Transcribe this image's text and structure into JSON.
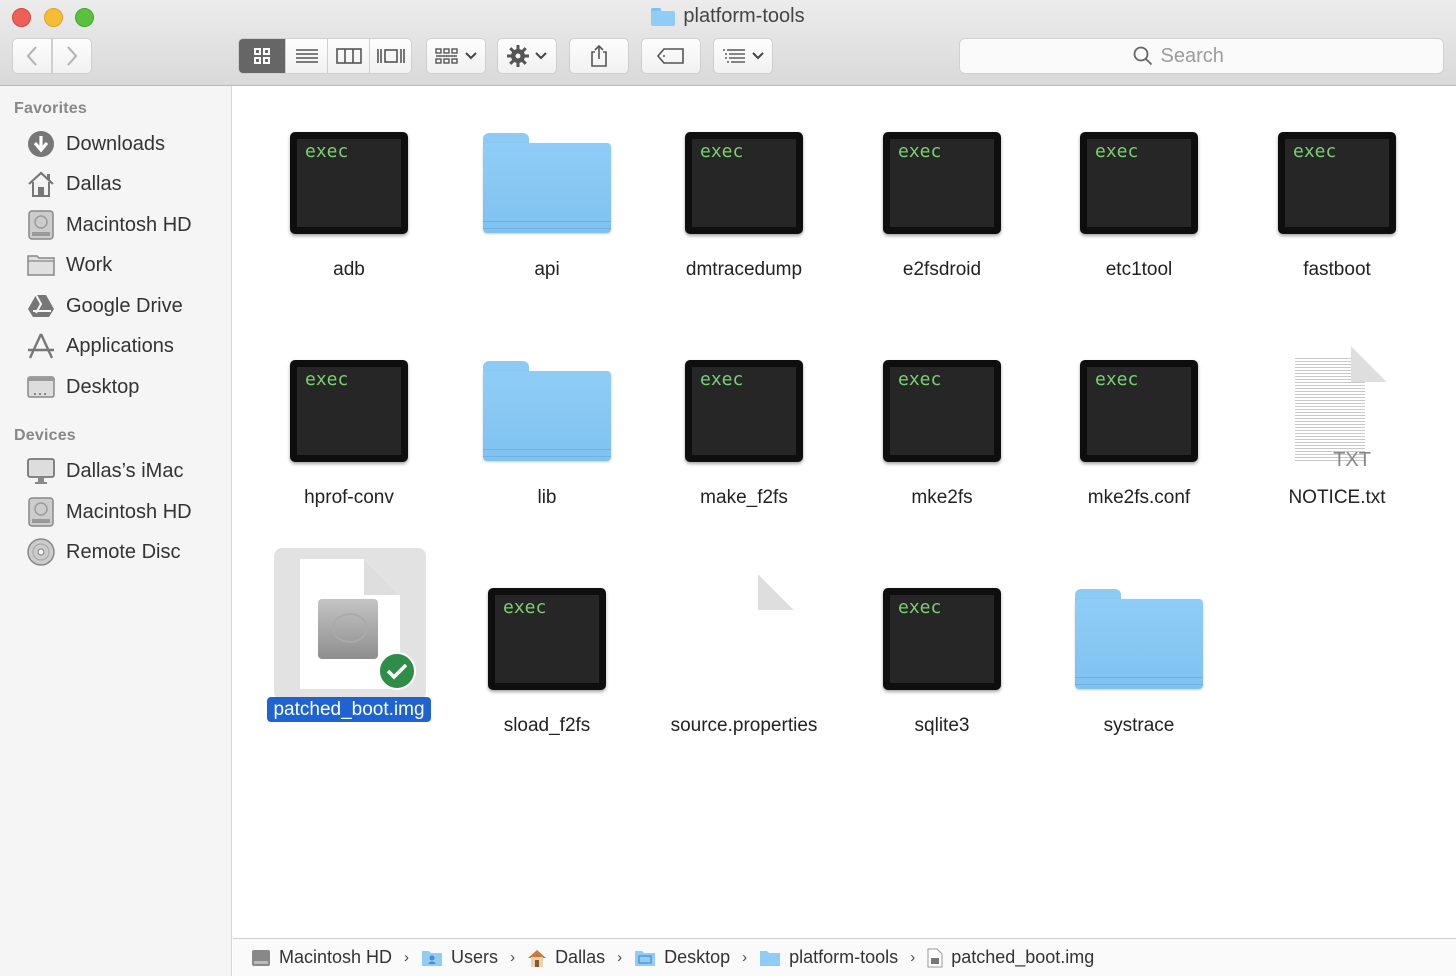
{
  "window": {
    "title": "platform-tools"
  },
  "toolbar": {
    "back_label": "Back",
    "forward_label": "Forward",
    "view_modes": [
      {
        "name": "icon-view",
        "active": true
      },
      {
        "name": "list-view",
        "active": false
      },
      {
        "name": "column-view",
        "active": false
      },
      {
        "name": "gallery-view",
        "active": false
      }
    ],
    "search_placeholder": "Search"
  },
  "sidebar": {
    "sections": [
      {
        "title": "Favorites",
        "items": [
          {
            "label": "Downloads",
            "icon": "downloads-icon"
          },
          {
            "label": "Dallas",
            "icon": "home-icon"
          },
          {
            "label": "Macintosh HD",
            "icon": "hard-drive-icon"
          },
          {
            "label": "Work",
            "icon": "folder-icon"
          },
          {
            "label": "Google Drive",
            "icon": "google-drive-icon"
          },
          {
            "label": "Applications",
            "icon": "applications-icon"
          },
          {
            "label": "Desktop",
            "icon": "desktop-icon"
          }
        ]
      },
      {
        "title": "Devices",
        "items": [
          {
            "label": "Dallas’s iMac",
            "icon": "imac-icon"
          },
          {
            "label": "Macintosh HD",
            "icon": "hard-drive-icon"
          },
          {
            "label": "Remote Disc",
            "icon": "disc-icon"
          }
        ]
      }
    ]
  },
  "files": [
    {
      "name": "adb",
      "type": "exec",
      "badge": "exec"
    },
    {
      "name": "api",
      "type": "folder"
    },
    {
      "name": "dmtracedump",
      "type": "exec",
      "badge": "exec"
    },
    {
      "name": "e2fsdroid",
      "type": "exec",
      "badge": "exec"
    },
    {
      "name": "etc1tool",
      "type": "exec",
      "badge": "exec"
    },
    {
      "name": "fastboot",
      "type": "exec",
      "badge": "exec"
    },
    {
      "name": "hprof-conv",
      "type": "exec",
      "badge": "exec"
    },
    {
      "name": "lib",
      "type": "folder"
    },
    {
      "name": "make_f2fs",
      "type": "exec",
      "badge": "exec"
    },
    {
      "name": "mke2fs",
      "type": "exec",
      "badge": "exec"
    },
    {
      "name": "mke2fs.conf",
      "type": "exec",
      "badge": "exec"
    },
    {
      "name": "NOTICE.txt",
      "type": "txt",
      "badge": "TXT"
    },
    {
      "name": "patched_boot.img",
      "type": "disk-image",
      "selected": true
    },
    {
      "name": "sload_f2fs",
      "type": "exec",
      "badge": "exec"
    },
    {
      "name": "source.properties",
      "type": "document"
    },
    {
      "name": "sqlite3",
      "type": "exec",
      "badge": "exec"
    },
    {
      "name": "systrace",
      "type": "folder"
    }
  ],
  "pathbar": [
    {
      "label": "Macintosh HD",
      "icon": "hard-drive-icon"
    },
    {
      "label": "Users",
      "icon": "users-folder-icon"
    },
    {
      "label": "Dallas",
      "icon": "home-icon"
    },
    {
      "label": "Desktop",
      "icon": "desktop-folder-icon"
    },
    {
      "label": "platform-tools",
      "icon": "folder-icon"
    },
    {
      "label": "patched_boot.img",
      "icon": "disk-image-icon"
    }
  ],
  "colors": {
    "selection": "#1f63d1",
    "folder": "#8fcdf6",
    "exec_text": "#7ccf72",
    "check_badge": "#2e8d46"
  }
}
